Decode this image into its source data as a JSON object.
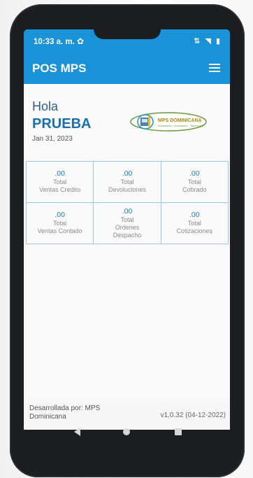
{
  "status_bar": {
    "time": "10:33 a. m.",
    "settings_icon": "gear-icon",
    "indicators": "⇅ ◥ ▮"
  },
  "app_bar": {
    "title": "POS MPS",
    "menu_icon": "hamburger-menu-icon"
  },
  "greeting": {
    "hello": "Hola",
    "user": "PRUEBA",
    "date": "Jan 31, 2023"
  },
  "logo": {
    "text": "MPS DOMINICANA",
    "subtitle": "Soluciones · Innovación · Tecnología"
  },
  "stats": [
    {
      "value": ".00",
      "label_line1": "Total",
      "label_line2": "Ventas Credito",
      "label_line3": ""
    },
    {
      "value": ".00",
      "label_line1": "Total",
      "label_line2": "Devoluciones",
      "label_line3": ""
    },
    {
      "value": ".00",
      "label_line1": "Total",
      "label_line2": "Cobrado",
      "label_line3": ""
    },
    {
      "value": ".00",
      "label_line1": "Total",
      "label_line2": "Ventas Contado",
      "label_line3": ""
    },
    {
      "value": ".00",
      "label_line1": "Total",
      "label_line2": "Ordenes",
      "label_line3": "Despacho"
    },
    {
      "value": ".00",
      "label_line1": "Total",
      "label_line2": "Cotizaciones",
      "label_line3": ""
    }
  ],
  "footer": {
    "developed_by": "Desarrollada por: MPS Dominicana",
    "version": "v1.0.32 (04-12-2022)"
  },
  "colors": {
    "primary": "#1a92d8",
    "accent_text": "#1a6fb0",
    "grid_border": "#9cc7e6"
  }
}
